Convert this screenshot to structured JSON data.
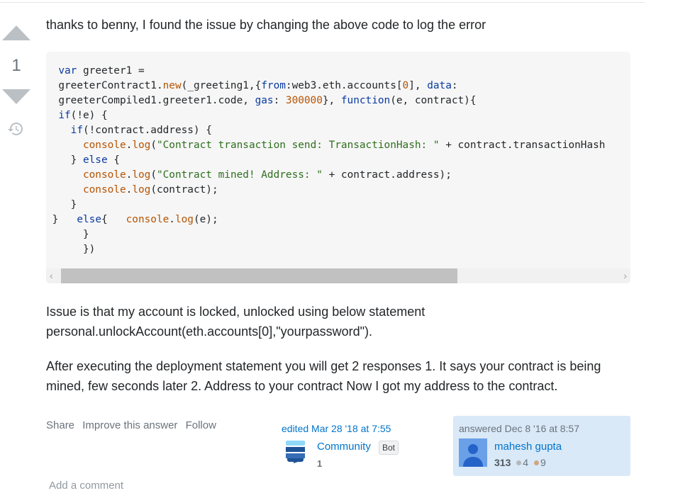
{
  "vote": {
    "count": "1"
  },
  "body": {
    "paragraph1": "thanks to benny, I found the issue by changing the above code to log the error",
    "paragraph2_line1": "Issue is that my account is locked, unlocked using below statement",
    "paragraph2_line2": "personal.unlockAccount(eth.accounts[0],\"yourpassword\").",
    "paragraph3": "After executing the deployment statement you will get 2 responses 1. It says your contract is being mined, few seconds later 2. Address to your contract Now I got my address to the contract."
  },
  "code": {
    "lines": [
      "var greeter1 =",
      "greeterContract1.new(_greeting1,{from:web3.eth.accounts[0], data:",
      "greeterCompiled1.greeter1.code, gas: 300000}, function(e, contract){",
      "if(!e) {",
      "  if(!contract.address) {",
      "    console.log(\"Contract transaction send: TransactionHash: \" + contract.transactionHash",
      "  } else {",
      "    console.log(\"Contract mined! Address: \" + contract.address);",
      "    console.log(contract);",
      "  }",
      "}   else{   console.log(e);",
      "    }",
      "    })"
    ]
  },
  "menu": {
    "share": "Share",
    "improve": "Improve this answer",
    "follow": "Follow"
  },
  "editor": {
    "time": "edited Mar 28 '18 at 7:55",
    "name": "Community",
    "badge": "Bot",
    "rep": "1"
  },
  "answerer": {
    "time": "answered Dec 8 '16 at 8:57",
    "name": "mahesh gupta",
    "rep": "313",
    "silver": "4",
    "bronze": "9"
  },
  "comments": {
    "add_label": "Add a comment"
  },
  "colors": {
    "link": "#0074cc",
    "answerer_bg": "#d9e9f7",
    "vote_arrow": "#bbc0c4"
  },
  "icons": {
    "vote_up": "triangle-up-icon",
    "vote_down": "triangle-down-icon",
    "history": "history-icon",
    "community": "stack-exchange-icon"
  }
}
